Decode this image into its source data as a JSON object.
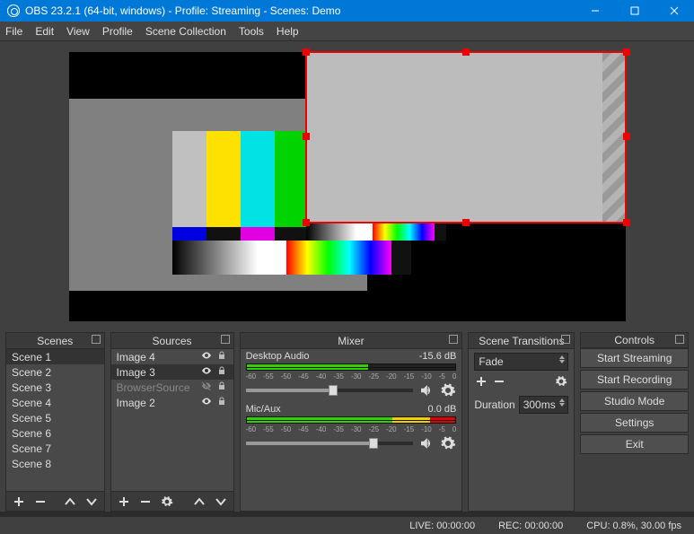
{
  "titlebar": {
    "title": "OBS 23.2.1 (64-bit, windows) - Profile: Streaming - Scenes: Demo"
  },
  "menu": [
    "File",
    "Edit",
    "View",
    "Profile",
    "Scene Collection",
    "Tools",
    "Help"
  ],
  "panels": {
    "scenes": {
      "title": "Scenes",
      "items": [
        "Scene 1",
        "Scene 2",
        "Scene 3",
        "Scene 4",
        "Scene 5",
        "Scene 6",
        "Scene 7",
        "Scene 8"
      ],
      "selected": 0
    },
    "sources": {
      "title": "Sources",
      "items": [
        {
          "label": "Image 4",
          "visible": true,
          "dim": false
        },
        {
          "label": "Image 3",
          "visible": true,
          "dim": false,
          "sel": true
        },
        {
          "label": "BrowserSource",
          "visible": false,
          "dim": true
        },
        {
          "label": "Image 2",
          "visible": true,
          "dim": false
        }
      ]
    },
    "mixer": {
      "title": "Mixer",
      "channels": [
        {
          "name": "Desktop Audio",
          "db": "-15.6 dB",
          "fill": 58,
          "thumb": 52
        },
        {
          "name": "Mic/Aux",
          "db": "0.0 dB",
          "fill": 100,
          "thumb": 76
        }
      ],
      "scale": [
        "-60",
        "-55",
        "-50",
        "-45",
        "-40",
        "-35",
        "-30",
        "-25",
        "-20",
        "-15",
        "-10",
        "-5",
        "0"
      ]
    },
    "transitions": {
      "title": "Scene Transitions",
      "mode": "Fade",
      "duration_label": "Duration",
      "duration": "300ms"
    },
    "controls": {
      "title": "Controls",
      "buttons": [
        "Start Streaming",
        "Start Recording",
        "Studio Mode",
        "Settings",
        "Exit"
      ]
    }
  },
  "status": {
    "live": "LIVE: 00:00:00",
    "rec": "REC: 00:00:00",
    "cpu": "CPU: 0.8%, 30.00 fps"
  }
}
